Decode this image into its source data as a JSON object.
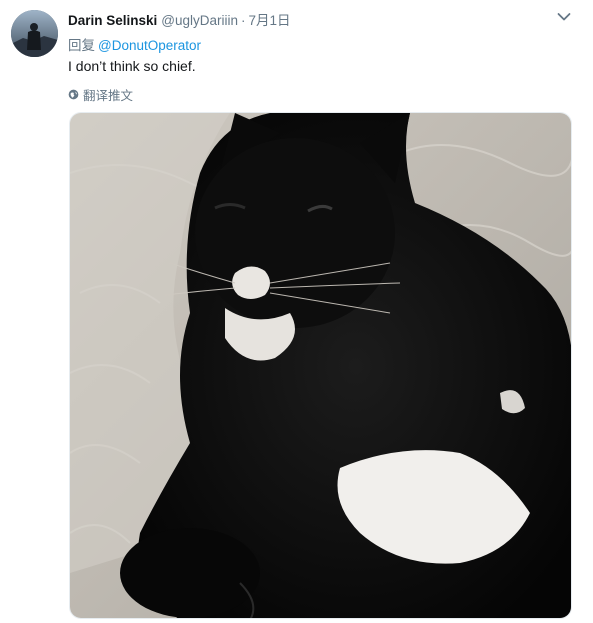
{
  "tweet": {
    "display_name": "Darin Selinski",
    "handle": "@uglyDariiin",
    "separator": "·",
    "date": "7月1日",
    "reply_prefix": "回复",
    "reply_to": "@DonutOperator",
    "text": "I don’t think so chief.",
    "translate_label": "翻译推文"
  },
  "icons": {
    "menu": "chevron-down-icon",
    "translate": "globe-icon"
  },
  "colors": {
    "link": "#1b95e0",
    "secondary_text": "#657786",
    "primary_text": "#14171a"
  }
}
